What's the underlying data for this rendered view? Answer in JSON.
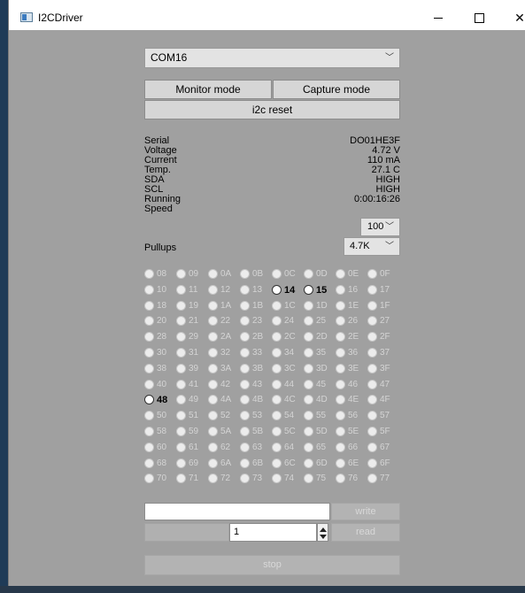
{
  "window": {
    "title": "I2CDriver",
    "icon": "app-window-icon",
    "controls": [
      "minimize-icon",
      "maximize-icon",
      "close-icon"
    ]
  },
  "port": {
    "selected": "COM16"
  },
  "modes": {
    "monitor": "Monitor mode",
    "capture": "Capture mode",
    "reset": "i2c reset"
  },
  "info": [
    {
      "label": "Serial",
      "value": "DO01HE3F"
    },
    {
      "label": "Voltage",
      "value": "4.72 V"
    },
    {
      "label": "Current",
      "value": "110 mA"
    },
    {
      "label": "Temp.",
      "value": "27.1 C"
    },
    {
      "label": "SDA",
      "value": "HIGH"
    },
    {
      "label": "SCL",
      "value": "HIGH"
    },
    {
      "label": "Running",
      "value": "0:00:16:26"
    },
    {
      "label": "Speed",
      "value": ""
    }
  ],
  "speed": {
    "selected": "100"
  },
  "pullups": {
    "label": "Pullups",
    "selected": "4.7K"
  },
  "addresses": [
    "08",
    "09",
    "0A",
    "0B",
    "0C",
    "0D",
    "0E",
    "0F",
    "10",
    "11",
    "12",
    "13",
    "14",
    "15",
    "16",
    "17",
    "18",
    "19",
    "1A",
    "1B",
    "1C",
    "1D",
    "1E",
    "1F",
    "20",
    "21",
    "22",
    "23",
    "24",
    "25",
    "26",
    "27",
    "28",
    "29",
    "2A",
    "2B",
    "2C",
    "2D",
    "2E",
    "2F",
    "30",
    "31",
    "32",
    "33",
    "34",
    "35",
    "36",
    "37",
    "38",
    "39",
    "3A",
    "3B",
    "3C",
    "3D",
    "3E",
    "3F",
    "40",
    "41",
    "42",
    "43",
    "44",
    "45",
    "46",
    "47",
    "48",
    "49",
    "4A",
    "4B",
    "4C",
    "4D",
    "4E",
    "4F",
    "50",
    "51",
    "52",
    "53",
    "54",
    "55",
    "56",
    "57",
    "58",
    "59",
    "5A",
    "5B",
    "5C",
    "5D",
    "5E",
    "5F",
    "60",
    "61",
    "62",
    "63",
    "64",
    "65",
    "66",
    "67",
    "68",
    "69",
    "6A",
    "6B",
    "6C",
    "6D",
    "6E",
    "6F",
    "70",
    "71",
    "72",
    "73",
    "74",
    "75",
    "76",
    "77"
  ],
  "active_addresses": [
    "14",
    "15",
    "48"
  ],
  "transfer": {
    "write_value": "",
    "write_label": "write",
    "count": "1",
    "read_label": "read",
    "stop_label": "stop"
  },
  "colors": {
    "panel": "#a0a0a0",
    "disabled_text": "#d4d4d4",
    "desktop": "#1f3b57"
  }
}
